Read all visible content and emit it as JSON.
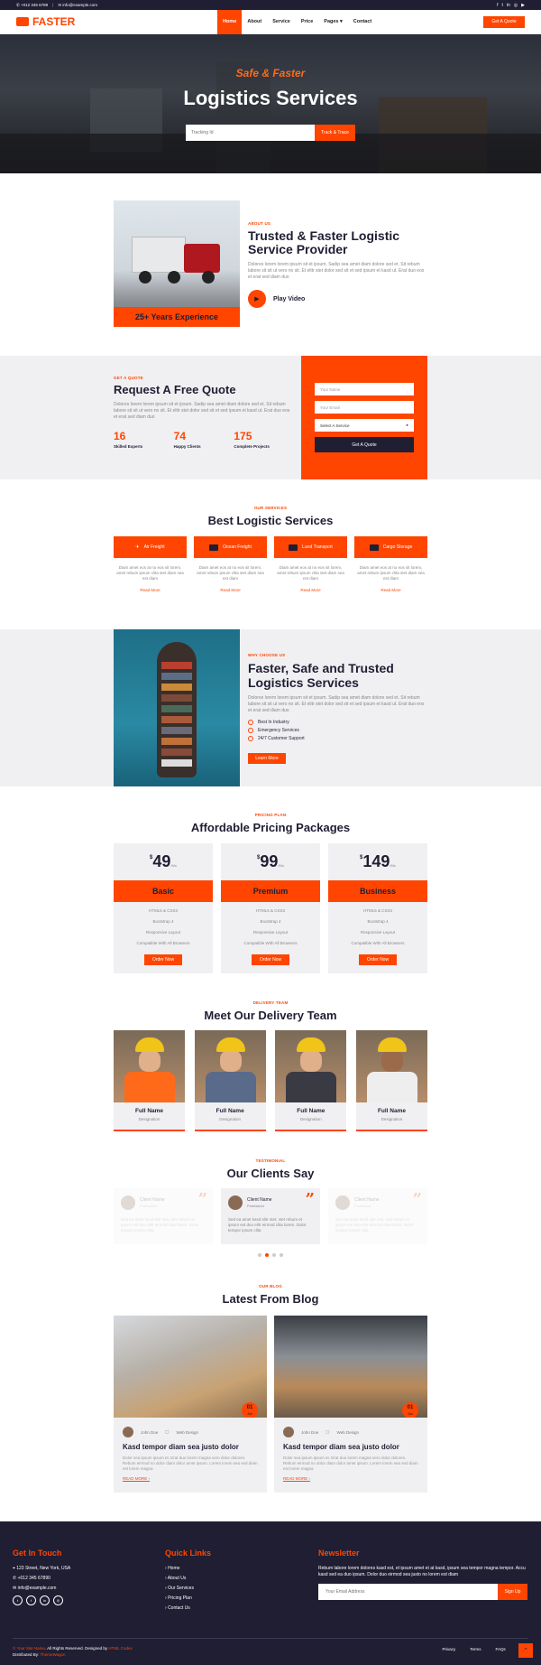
{
  "topbar": {
    "phone": "+012 345 6789",
    "email": "info@example.com"
  },
  "brand": {
    "name": "FASTER"
  },
  "nav": {
    "items": [
      "Home",
      "About",
      "Service",
      "Price",
      "Pages ▾",
      "Contact"
    ],
    "cta": "Get A Quote"
  },
  "hero": {
    "subtitle": "Safe & Faster",
    "title": "Logistics Services",
    "placeholder": "Tracking Id",
    "button": "Track & Trace"
  },
  "about": {
    "badge": "25+ Years Experience",
    "tag": "ABOUT US",
    "title": "Trusted & Faster Logistic Service Provider",
    "text": "Dolores lorem lorem ipsum sit et ipsum. Sadip sea amet diam dolore sed et. Sit rebum labore sit sit ut vero no sit. Et elitr stet dolor sed sit et sed ipsum et kasd ut. Erat duo eos et erat sed diam duo",
    "play": "Play Video"
  },
  "quote": {
    "tag": "GET A QUOTE",
    "title": "Request A Free Quote",
    "text": "Dolores lorem lorem ipsum sit et ipsum. Sadip sea amet diam dolore sed et. Sit rebum labore sit sit ut vero no sit. Et elitr stet dolor sed sit et sed ipsum et kasd ut. Erat duo eos et erat sed diam duo",
    "stats": [
      {
        "num": "16",
        "label": "Skilled Experts"
      },
      {
        "num": "74",
        "label": "Happy Clients"
      },
      {
        "num": "175",
        "label": "Complete Projects"
      }
    ],
    "name_ph": "Your Name",
    "email_ph": "Your Email",
    "select": "Select A Service",
    "button": "Get A Quote"
  },
  "services": {
    "tag": "OUR SERVICES",
    "title": "Best Logistic Services",
    "items": [
      {
        "name": "Air Freight",
        "icon": "plane-icon"
      },
      {
        "name": "Ocean Freight",
        "icon": "ship-icon"
      },
      {
        "name": "Land Transport",
        "icon": "truck-icon"
      },
      {
        "name": "Cargo Storage",
        "icon": "warehouse-icon"
      }
    ],
    "text": "Diam amet eos at no eos sit lorem, amet rebum ipsum clita stet diam sea est diam",
    "more": "Read More"
  },
  "why": {
    "tag": "WHY CHOOSE US",
    "title": "Faster, Safe and Trusted Logistics Services",
    "text": "Dolores lorem lorem ipsum sit et ipsum. Sadip sea amet diam dolore sed et. Sit rebum labore sit sit ut vero no sit. Et elitr stet dolor sed sit et sed ipsum et kasd ut. Erat duo eos et erat sed diam duo",
    "checks": [
      "Best In Industry",
      "Emergency Services",
      "24/7 Customer Support"
    ],
    "button": "Learn More"
  },
  "pricing": {
    "tag": "PRICING PLAN",
    "title": "Affordable Pricing Packages",
    "plans": [
      {
        "currency": "$",
        "price": "49",
        "per": "/Mo",
        "name": "Basic"
      },
      {
        "currency": "$",
        "price": "99",
        "per": "/Mo",
        "name": "Premium"
      },
      {
        "currency": "$",
        "price": "149",
        "per": "/Mo",
        "name": "Business"
      }
    ],
    "features": [
      "HTML5 & CSS3",
      "Bootstrap 4",
      "Responsive Layout",
      "Compatible With All Browsers"
    ],
    "button": "Order Now"
  },
  "team": {
    "tag": "DELIVERY TEAM",
    "title": "Meet Our Delivery Team",
    "name": "Full Name",
    "role": "Designation"
  },
  "testimonials": {
    "tag": "TESTIMONIAL",
    "title": "Our Clients Say",
    "name": "Client Name",
    "profession": "Profession",
    "text": "Sed ea amet kasd elitr stet, stet rebum et ipsum est duo elitr eirmod clita lorem. Dolor tempor ipsum clita"
  },
  "blog": {
    "tag": "OUR BLOG",
    "title": "Latest From Blog",
    "date_day": "01",
    "date_month": "Jan",
    "author": "John Doe",
    "category": "Web Design",
    "post_title": "Kasd tempor diam sea justo dolor",
    "text": "Dolor sea ipsum ipsum et. Erat duo lorem magna vero dolor dolores. Rebum eirmod no dolor diam dolor amet ipsum. Lorem lorem sea sed diam est lorem magna",
    "more": "READ MORE ›"
  },
  "footer": {
    "contact_title": "Get In Touch",
    "address": "123 Street, New York, USA",
    "phone": "+012 345 67890",
    "email": "info@example.com",
    "links_title": "Quick Links",
    "links": [
      "Home",
      "About Us",
      "Our Services",
      "Pricing Plan",
      "Contact Us"
    ],
    "newsletter_title": "Newsletter",
    "newsletter_text": "Rebum labore lorem dolores kasd est, et ipsum amet et at kasd, ipsum sea tempor magna tempor. Accu kasd sed ea duo ipsum. Dolor duo eirmod sea justo no lorem est diam",
    "newsletter_ph": "Your Email Address",
    "signup": "Sign Up",
    "copy_symbol": "©",
    "site_name": "Your Site Name",
    "rights": ". All Rights Reserved. Designed by",
    "designer": "HTML Codex",
    "distributed": "Distributed By:",
    "distributor": "ThemeWagon",
    "bottom_links": [
      "Privacy",
      "Terms",
      "FAQs",
      "Help"
    ]
  },
  "colors": {
    "accent": "#ff4500",
    "dark": "#1f1e33",
    "light": "#f0f0f3"
  }
}
